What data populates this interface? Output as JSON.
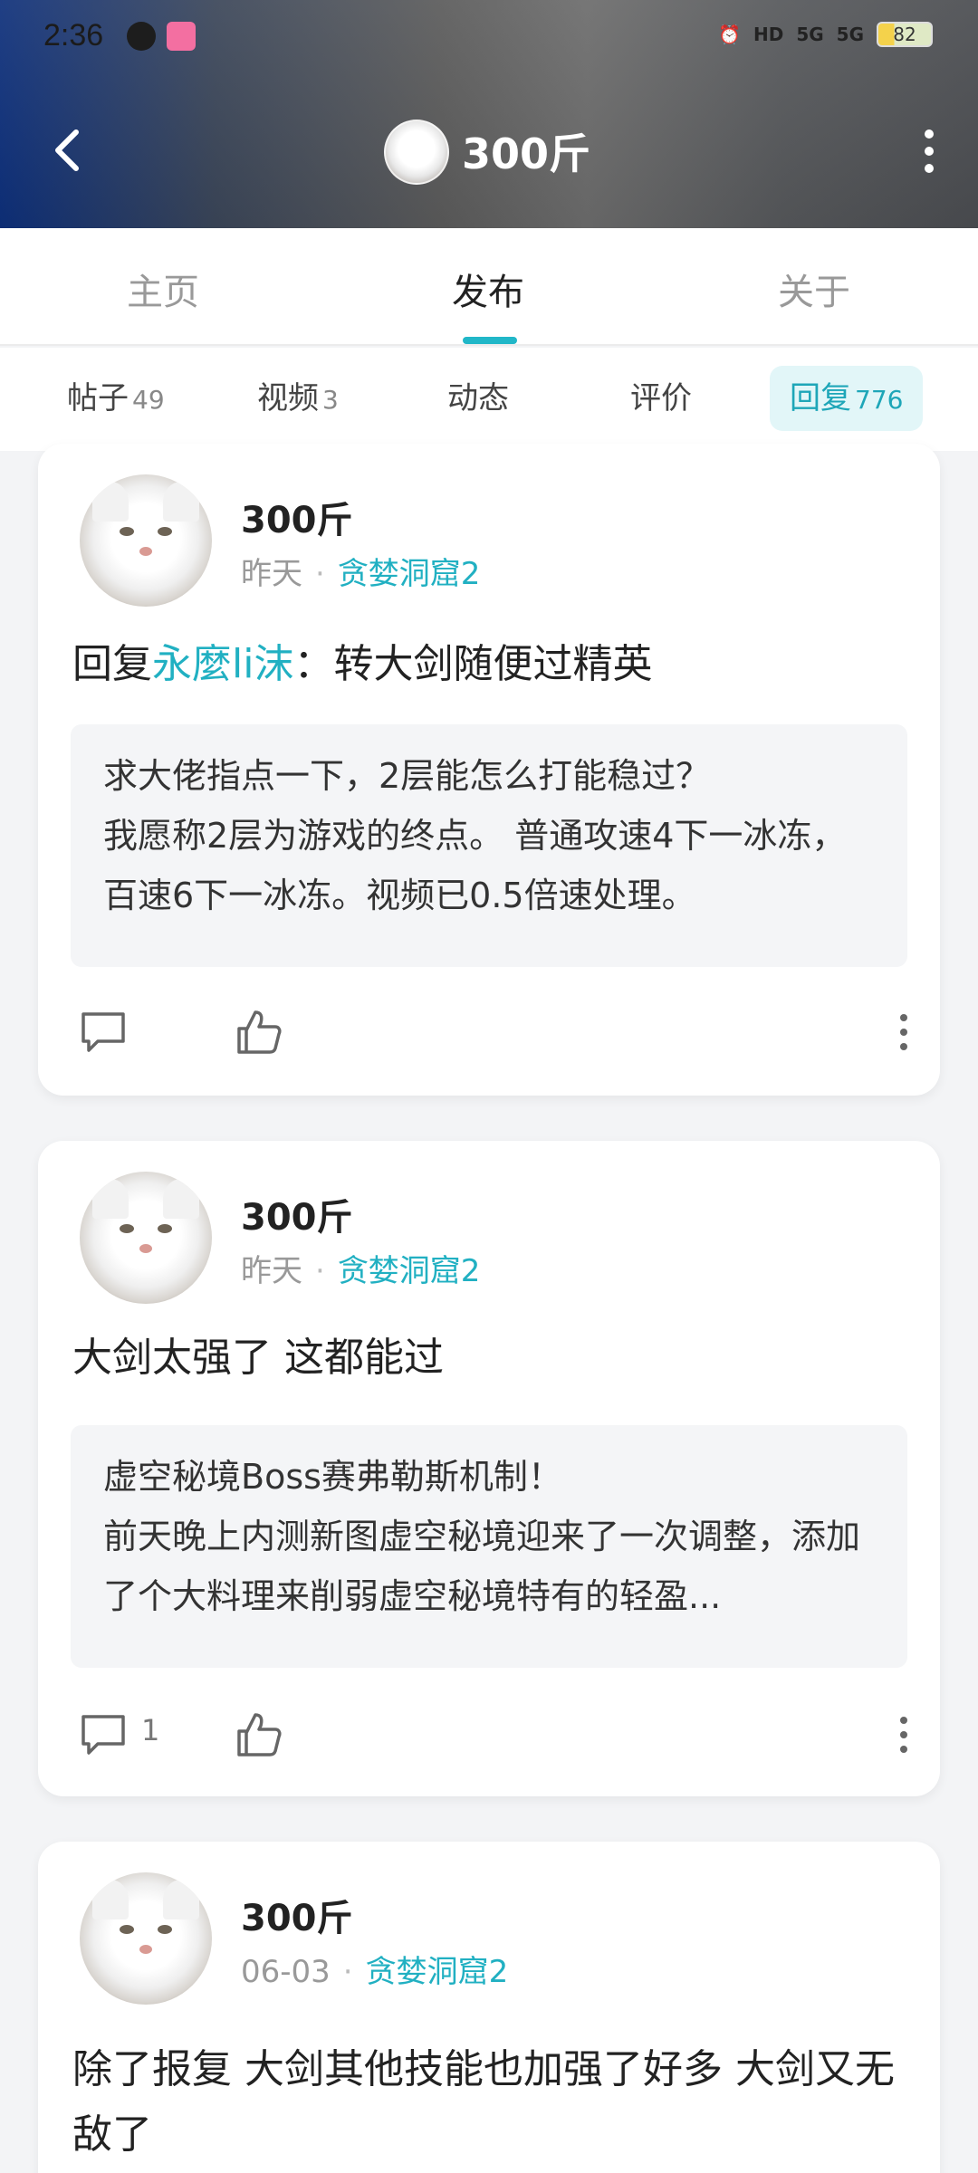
{
  "status_bar": {
    "time": "2:36",
    "network_1": "HD",
    "network_2": "5G",
    "network_3": "5G",
    "battery": "82"
  },
  "header": {
    "title": "300斤"
  },
  "tabs": [
    {
      "label": "主页"
    },
    {
      "label": "发布"
    },
    {
      "label": "关于"
    }
  ],
  "subtabs": [
    {
      "label": "帖子",
      "count": "49"
    },
    {
      "label": "视频",
      "count": "3"
    },
    {
      "label": "动态",
      "count": ""
    },
    {
      "label": "评价",
      "count": ""
    },
    {
      "label": "回复",
      "count": "776"
    }
  ],
  "posts": [
    {
      "author": "300斤",
      "time": "昨天",
      "game": "贪婪洞窟2",
      "reply_prefix": "回复",
      "mention": "永麼li沫",
      "text": "：转大剑随便过精英",
      "quote_title": "求大佬指点一下，2层能怎么打能稳过？",
      "quote_body": "我愿称2层为游戏的终点。 普通攻速4下一冰冻，百速6下一冰冻。视频已0.5倍速处理。",
      "comment_count": ""
    },
    {
      "author": "300斤",
      "time": "昨天",
      "game": "贪婪洞窟2",
      "text": "大剑太强了 这都能过",
      "quote_title": "虚空秘境Boss赛弗勒斯机制！",
      "quote_body": "前天晚上内测新图虚空秘境迎来了一次调整，添加了个大料理来削弱虚空秘境特有的轻盈...",
      "comment_count": "1"
    },
    {
      "author": "300斤",
      "time": "06-03",
      "game": "贪婪洞窟2",
      "text": "除了报复 大剑其他技能也加强了好多 大剑又无敌了"
    }
  ],
  "colors": {
    "accent": "#21b0c2",
    "active_tab_bg": "#e2f6f8"
  }
}
